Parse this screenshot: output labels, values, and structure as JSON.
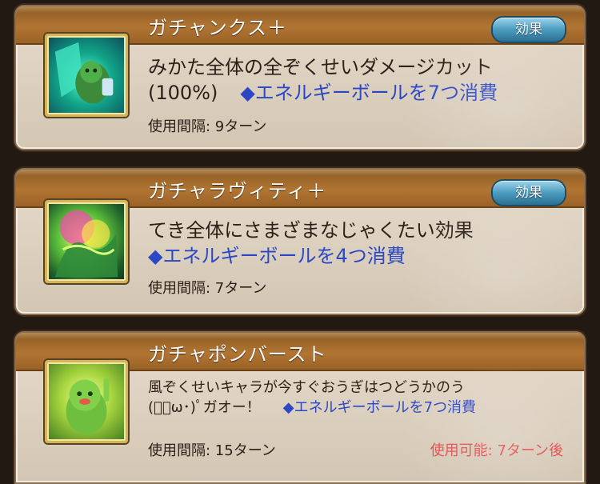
{
  "skills": [
    {
      "name": "ガチャンクス＋",
      "effect_label": "効果",
      "icon": "shield-guard-icon",
      "desc_line1": "みかた全体の全ぞくせいダメージカット",
      "desc_line2_pre": "(100%)",
      "energy": "◆エネルギーボールを7つ消費",
      "interval": "使用間隔: 9ターン"
    },
    {
      "name": "ガチャラヴィティ＋",
      "effect_label": "効果",
      "icon": "green-aura-burst-icon",
      "desc_line1": "てき全体にさまざまなじゃくたい効果",
      "energy": "◆エネルギーボールを4つ消費",
      "interval": "使用間隔: 7ターン"
    },
    {
      "name": "ガチャポンバースト",
      "icon": "green-mascot-icon",
      "desc_line1": "風ぞくせいキャラが今すぐおうぎはつどうかのう",
      "desc_line2_pre": "(ﾟ･ω･)ﾟガオー！",
      "energy": "◆エネルギーボールを7つ消費",
      "interval": "使用間隔: 15ターン",
      "availability": "使用可能: 7ターン後"
    }
  ],
  "colors": {
    "header_brown": "#b17532",
    "energy_blue": "#2b47c6",
    "warning_red": "#e24a4a",
    "effect_button_blue": "#4b9cc0"
  }
}
